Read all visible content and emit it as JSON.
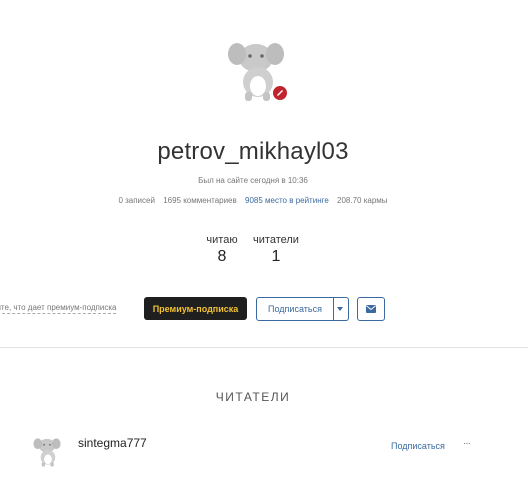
{
  "profile": {
    "username": "petrov_mikhayl03",
    "last_seen": "Был на сайте сегодня в 10:36",
    "stats": {
      "posts": "0 записей",
      "comments": "1695 комментариев",
      "rating": "9085 место в рейтинге",
      "karma": "208.70 кармы"
    },
    "counters": {
      "following_label": "читаю",
      "following_value": "8",
      "readers_label": "читатели",
      "readers_value": "1"
    }
  },
  "actions": {
    "premium_link": "айте, что дает премиум-подписка",
    "premium_button": "Премиум-подписка",
    "subscribe_button": "Подписаться"
  },
  "readers_section": {
    "title": "ЧИТАТЕЛИ",
    "items": [
      {
        "name": "sintegma777",
        "subscribe_label": "Подписаться",
        "more_label": "···"
      }
    ]
  },
  "colors": {
    "accent": "#3b6aa0",
    "premium_bg": "#1f1f1f",
    "premium_text": "#f2c230",
    "badge": "#c0242e"
  }
}
